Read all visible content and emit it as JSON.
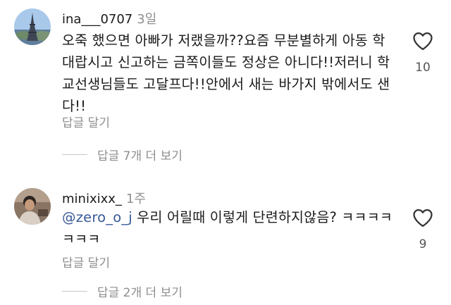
{
  "comments": [
    {
      "username": "ina___0707",
      "time": "3일",
      "text": "오죽 했으면 아빠가 저랬을까??요즘 무분별하게 아동 학대랍시고 신고하는 금쪽이들도 정상은 아니다!!저러니 학교선생님들도 고달프다!!안에서 새는 바가지 밖에서도 샌다!!",
      "reply_label": "답글 달기",
      "view_replies": "답글 7개 더 보기",
      "likes": "10"
    },
    {
      "username": "minixixx_",
      "time": "1주",
      "mention": "@zero_o_j",
      "text": " 우리 어릴때 이렇게 단련하지않음? ㅋㅋㅋㅋㅋㅋㅋ",
      "reply_label": "답글 달기",
      "view_replies": "답글 2개 더 보기",
      "likes": "9"
    }
  ],
  "icons": {
    "like": "heart-outline-icon"
  }
}
